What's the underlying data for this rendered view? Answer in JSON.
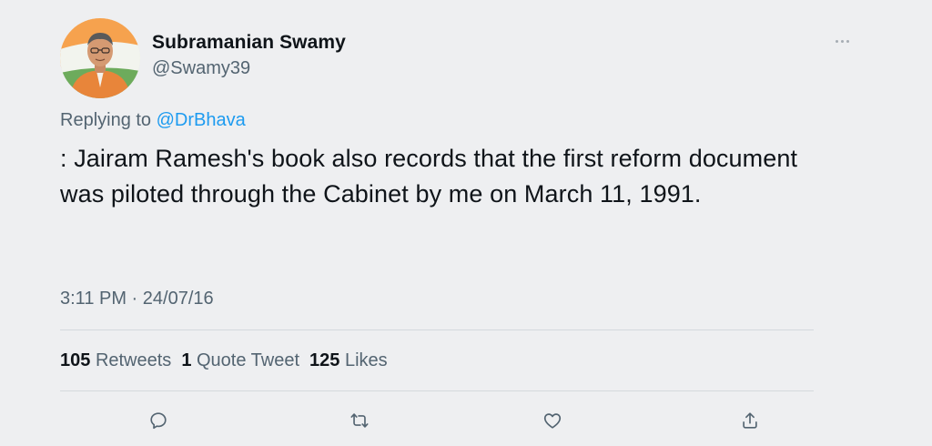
{
  "author": {
    "display_name": "Subramanian Swamy",
    "handle": "@Swamy39",
    "avatar_icon": "profile-photo"
  },
  "reply": {
    "prefix": "Replying to",
    "mention": "@DrBhava"
  },
  "tweet": {
    "text": ": Jairam Ramesh's book also records that the first reform document was piloted through the Cabinet by me on March 11, 1991.",
    "timestamp": "3:11 PM · 24/07/16"
  },
  "stats": {
    "retweets_count": "105",
    "retweets_label": "Retweets",
    "quote_count": "1",
    "quote_label": "Quote Tweet",
    "likes_count": "125",
    "likes_label": "Likes"
  },
  "actions": {
    "reply_icon": "reply-icon",
    "retweet_icon": "retweet-icon",
    "like_icon": "heart-icon",
    "share_icon": "share-icon"
  },
  "colors": {
    "background": "#eeeff1",
    "text_primary": "#0f1419",
    "text_secondary": "#536471",
    "accent": "#1d9bf0"
  }
}
